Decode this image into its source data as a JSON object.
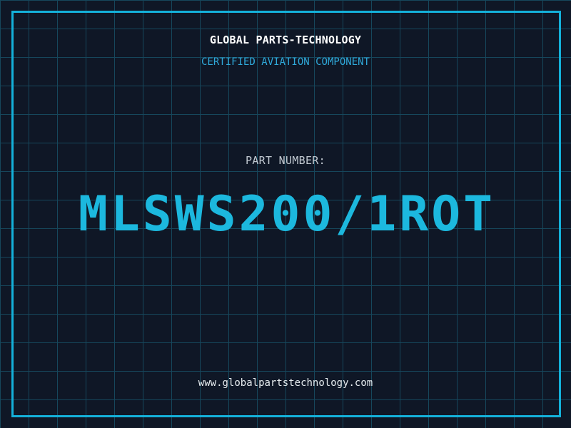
{
  "header": {
    "company": "GLOBAL PARTS-TECHNOLOGY",
    "subtitle": "CERTIFIED AVIATION COMPONENT"
  },
  "part": {
    "label": "PART NUMBER:",
    "number": "MLSWS200/1ROT"
  },
  "footer": {
    "website": "www.globalpartstechnology.com"
  },
  "colors": {
    "background": "#0f1726",
    "grid_line": "#16475c",
    "frame_border": "#14b1da",
    "title_color": "#ffffff",
    "subtitle_color": "#2fa9da",
    "part_label_color": "#c2cad2",
    "part_number_color": "#1cb8de",
    "website_color": "#e6ecef"
  }
}
